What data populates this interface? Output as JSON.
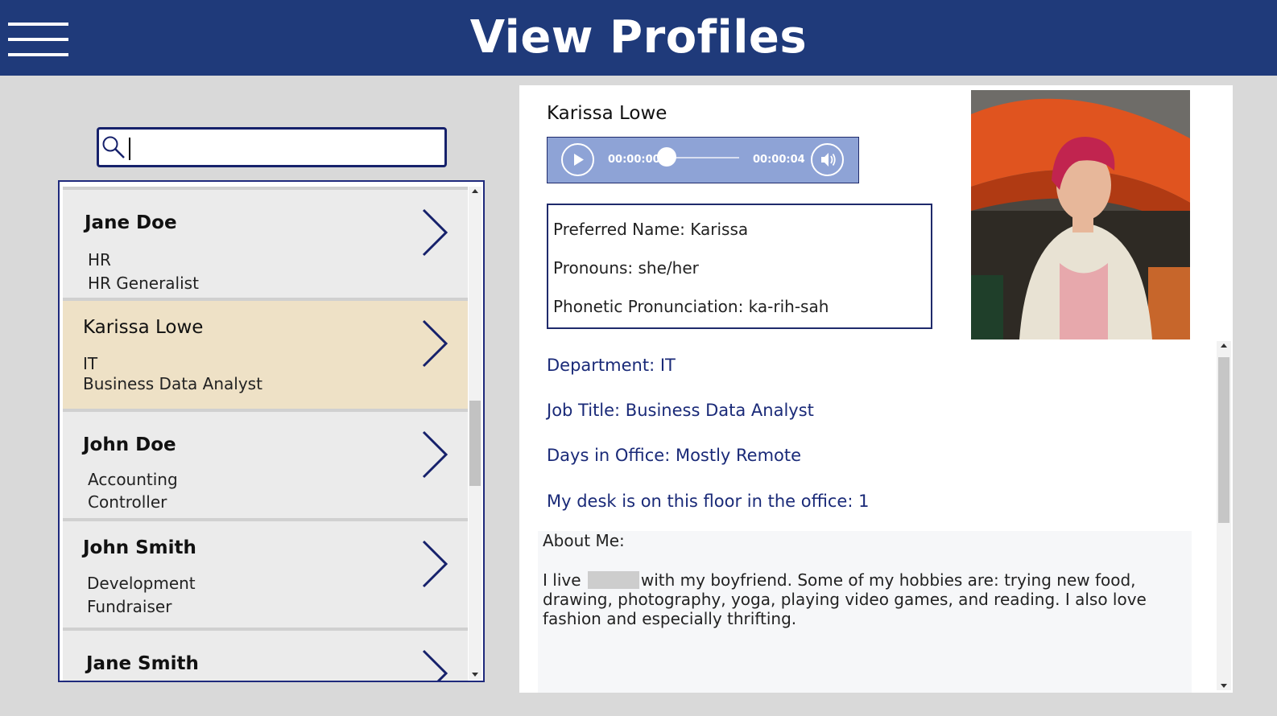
{
  "header": {
    "title": "View Profiles",
    "menu_icon": "hamburger-menu-icon"
  },
  "search": {
    "value": "",
    "icon": "search-icon"
  },
  "list": {
    "items": [
      {
        "name": "Jane Doe",
        "department": "HR",
        "job_title": "HR Generalist",
        "selected": false
      },
      {
        "name": "Karissa Lowe",
        "department": "IT",
        "job_title": "Business Data Analyst",
        "selected": true
      },
      {
        "name": "John Doe",
        "department": "Accounting",
        "job_title": "Controller",
        "selected": false
      },
      {
        "name": "John Smith",
        "department": "Development",
        "job_title": "Fundraiser",
        "selected": false
      },
      {
        "name": "Jane Smith",
        "department": "",
        "job_title": "",
        "selected": false
      }
    ],
    "chevron_icon": "chevron-right-icon"
  },
  "profile": {
    "name": "Karissa Lowe",
    "audio": {
      "current_time": "00:00:00",
      "duration": "00:00:04",
      "progress": 0
    },
    "info": {
      "preferred_name": "Preferred Name:  Karissa",
      "pronouns": "Pronouns:  she/her",
      "phonetic": "Phonetic Pronunciation:  ka-rih-sah"
    },
    "fields": {
      "department": "Department:  IT",
      "job_title": "Job Title:  Business Data Analyst",
      "days_in_office": "Days in Office:  Mostly Remote",
      "desk_floor": "My desk is on this floor in the office:  1"
    },
    "about": {
      "heading": "About Me:",
      "text_before": "I live",
      "text_after": "with my boyfriend. Some of my hobbies are: trying new food, drawing, photography, yoga, playing video games, and reading. I also love fashion and especially thrifting."
    }
  },
  "colors": {
    "header": "#1f3a7a",
    "selected_row": "#eee1c6",
    "accent_text": "#1a2a78",
    "audio_bg": "#8ea3d6"
  }
}
